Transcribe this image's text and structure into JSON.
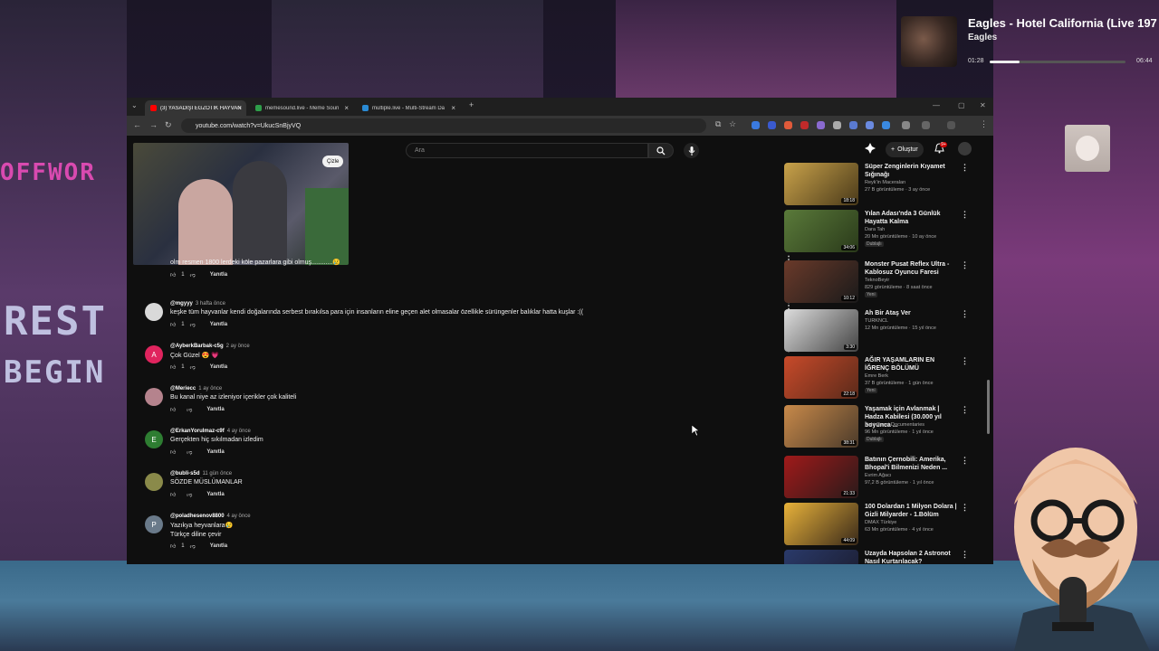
{
  "now_playing": {
    "title": "Eagles - Hotel California (Live 197",
    "artist": "Eagles",
    "current_time": "01:28",
    "duration": "06:44",
    "progress": 0.22
  },
  "browser": {
    "tabs": [
      {
        "label": "(3) YASADIŞI EGZOTİK HAYVAN",
        "active": true
      },
      {
        "label": "memesound.live - Meme Soun"
      },
      {
        "label": "multiple.live - Multi-Stream Da"
      }
    ],
    "new_tab": "+",
    "url": "youtube.com/watch?v=UkucSnBjyVQ"
  },
  "youtube": {
    "subscribe_label": "Çizle",
    "search_placeholder": "Ara",
    "create_label": "Oluştur",
    "notification_count": "9+",
    "reply_label": "Yanıtla",
    "comments": [
      {
        "author": "",
        "time": "",
        "text": "olm resmen 1800 lerdeki köle pazarlara gibi olmuş............😢",
        "likes": "1",
        "avatar_letter": "",
        "avatar_color": "#0f0f0f"
      },
      {
        "author": "@mgyyy",
        "time": "3 hafta önce",
        "text": "keşke tüm hayvanlar kendi doğalarında serbest bırakılsa para için insanların eline geçen alet olmasalar özellikle sürüngenler balıklar hatta kuşlar :((",
        "likes": "1",
        "avatar_letter": "",
        "avatar_color": "#d9d9d9"
      },
      {
        "author": "@AyberkBarbak-c5g",
        "time": "2 ay önce",
        "text": "Çok Güzel 😍 💗",
        "likes": "1",
        "avatar_letter": "A",
        "avatar_color": "#e0245e"
      },
      {
        "author": "@Meriecc",
        "time": "1 ay önce",
        "text": "Bu kanal niye az izleniyor içerikler çok kaliteli",
        "likes": "",
        "avatar_letter": "",
        "avatar_color": "#b5838d"
      },
      {
        "author": "@ErkanYorulmaz-c9f",
        "time": "4 ay önce",
        "text": "Gerçekten hiç sıkılmadan izledim",
        "likes": "",
        "avatar_letter": "E",
        "avatar_color": "#2e7d32"
      },
      {
        "author": "@bubli-s5d",
        "time": "11 gün önce",
        "text": "SÖZDE MÜSLÜMANLAR",
        "likes": "",
        "avatar_letter": "",
        "avatar_color": "#8a8a4a"
      },
      {
        "author": "@poladhesenov8800",
        "time": "4 ay önce",
        "text": "Yazıkya heyvanlara😢",
        "text2": "Türkçe diline çevir",
        "likes": "1",
        "avatar_letter": "P",
        "avatar_color": "#6a7a8a"
      }
    ],
    "recommendations": [
      {
        "title": "Süper Zenginlerin Kıyamet Sığınağı",
        "channel": "Reyk'in Maceraları",
        "meta": "27 B görüntüleme · 3 ay önce",
        "badge": "",
        "duration": "18:18",
        "thumb": "linear-gradient(135deg,#c9a24a,#4a3a1a)"
      },
      {
        "title": "Yılan Adası'nda 3 Günlük Hayatta Kalma",
        "channel": "Dara Tah",
        "meta": "20 Mn görüntüleme · 10 ay önce",
        "badge": "Dublajlı",
        "duration": "34:06",
        "thumb": "linear-gradient(135deg,#5a7a3a,#2a3a1a)"
      },
      {
        "title": "Monster Pusat Reflex Ultra - Kablosuz Oyuncu Faresi",
        "channel": "TeknoBeyir",
        "meta": "829 görüntüleme · 8 saat önce",
        "badge": "Yeni",
        "duration": "10:12",
        "thumb": "linear-gradient(135deg,#6a3a2a,#1a1a1a)"
      },
      {
        "title": "Ah Bir Ataş Ver",
        "channel": "TURKNCL",
        "meta": "12 Mn görüntüleme · 15 yıl önce",
        "badge": "",
        "duration": "3:30",
        "thumb": "linear-gradient(135deg,#ddd,#444)"
      },
      {
        "title": "AĞIR YAŞAMLARIN EN İĞRENÇ BÖLÜMÜ",
        "channel": "Emre Berk",
        "meta": "37 B görüntüleme · 1 gün önce",
        "badge": "Yeni",
        "duration": "22:18",
        "thumb": "linear-gradient(135deg,#c84a2a,#5a2a1a)"
      },
      {
        "title": "Yaşamak için Avlanmak | Hadza Kabilesi (30.000 yıl boyunca ...",
        "channel": "Rahi Cenet Documentaries",
        "meta": "96 Mn görüntüleme · 1 yıl önce",
        "badge": "Dublajlı",
        "duration": "38:31",
        "thumb": "linear-gradient(135deg,#c98a4a,#4a3a2a)"
      },
      {
        "title": "Batının Çernobili: Amerika, Bhopal'i Bilmenizi Neden ...",
        "channel": "Evrim Ağacı",
        "meta": "97,2 B görüntüleme · 1 yıl önce",
        "badge": "",
        "duration": "21:33",
        "thumb": "linear-gradient(135deg,#a01a1a,#2a1a1a)"
      },
      {
        "title": "100 Dolardan 1 Milyon Dolara | Gizli Milyarder - 1.Bölüm",
        "channel": "DMAX Türkiye",
        "meta": "63 Mn görüntüleme · 4 yıl önce",
        "badge": "",
        "duration": "44:09",
        "thumb": "linear-gradient(135deg,#e8b23a,#3a2a1a)"
      },
      {
        "title": "Uzayda Hapsolan 2 Astronot Nasıl Kurtarılacak?",
        "channel": "",
        "meta": "",
        "badge": "",
        "duration": "",
        "thumb": "linear-gradient(135deg,#2a3a6a,#1a1a2a)"
      }
    ]
  },
  "colors": {
    "youtube_red": "#ff0000",
    "bg": "#0f0f0f"
  }
}
